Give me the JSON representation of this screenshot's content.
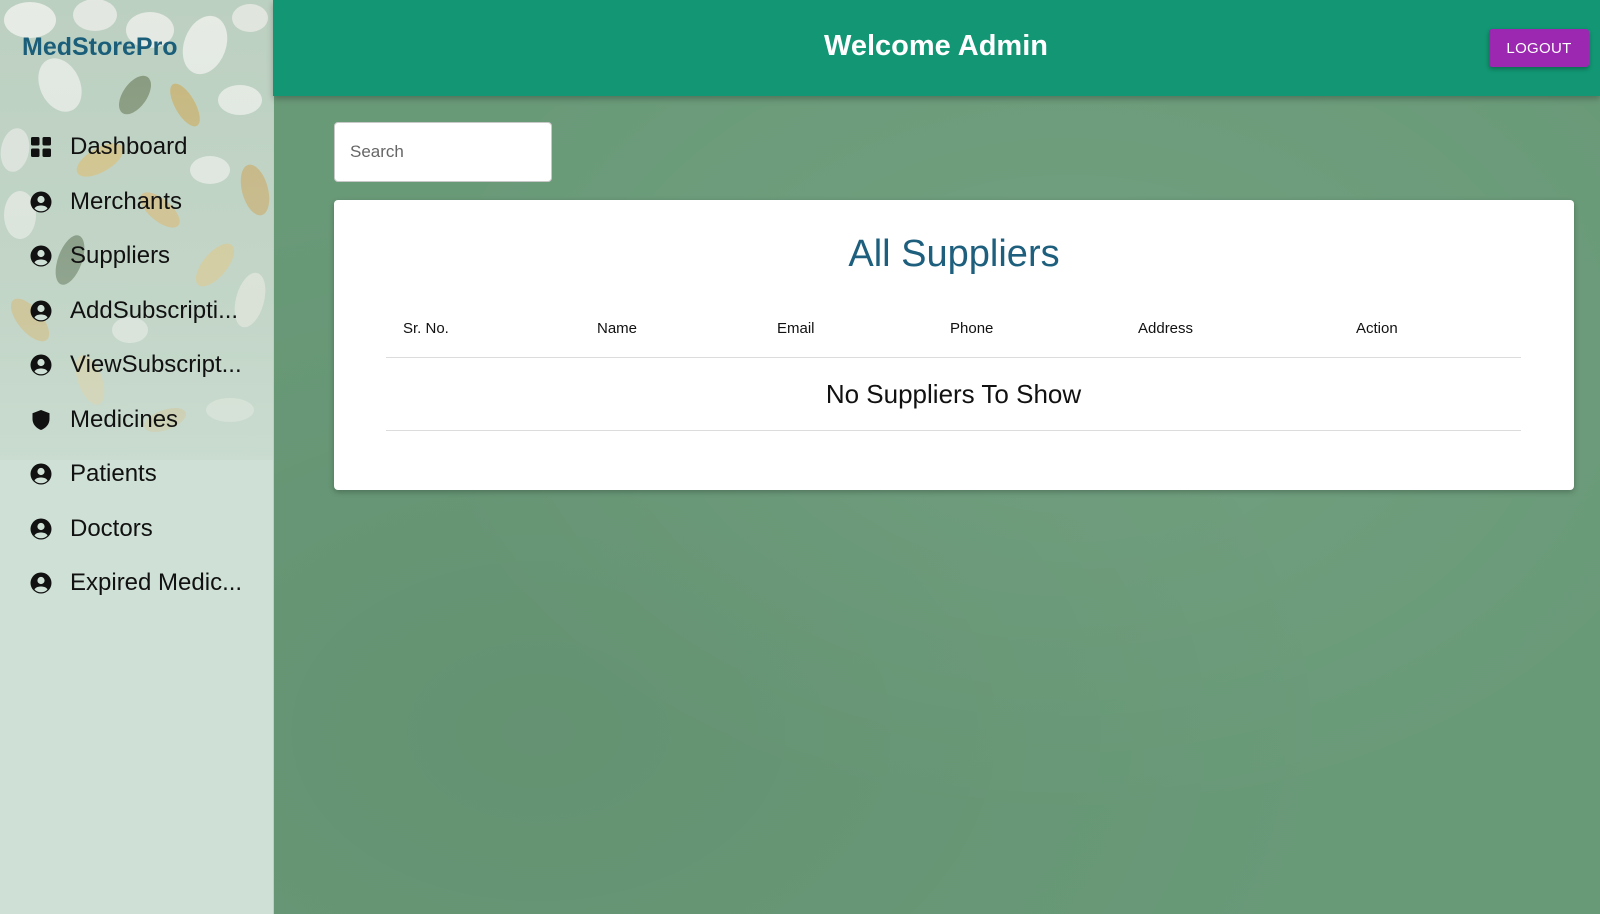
{
  "sidebar": {
    "brand": "MedStorePro",
    "items": [
      {
        "label": "Dashboard",
        "icon": "dashboard-grid-icon"
      },
      {
        "label": "Merchants",
        "icon": "user-circle-icon"
      },
      {
        "label": "Suppliers",
        "icon": "user-circle-icon"
      },
      {
        "label": "AddSubscripti...",
        "icon": "user-circle-icon"
      },
      {
        "label": "ViewSubscript...",
        "icon": "user-circle-icon"
      },
      {
        "label": "Medicines",
        "icon": "shield-icon"
      },
      {
        "label": "Patients",
        "icon": "user-circle-icon"
      },
      {
        "label": "Doctors",
        "icon": "user-circle-icon"
      },
      {
        "label": "Expired Medic...",
        "icon": "user-circle-icon"
      }
    ]
  },
  "header": {
    "title": "Welcome Admin",
    "logout_label": "LOGOUT"
  },
  "search": {
    "placeholder": "Search",
    "value": ""
  },
  "main": {
    "card_title": "All Suppliers",
    "table": {
      "columns": [
        "Sr. No.",
        "Name",
        "Email",
        "Phone",
        "Address",
        "Action"
      ],
      "rows": [],
      "empty_message": "No Suppliers To Show"
    }
  },
  "colors": {
    "header_bg": "#129673",
    "logout_bg": "#9c27b0",
    "brand_text": "#1b5e7a",
    "card_title": "#1d5f7d",
    "main_bg": "#699a78",
    "sidebar_bg": "#cfe1d6"
  }
}
